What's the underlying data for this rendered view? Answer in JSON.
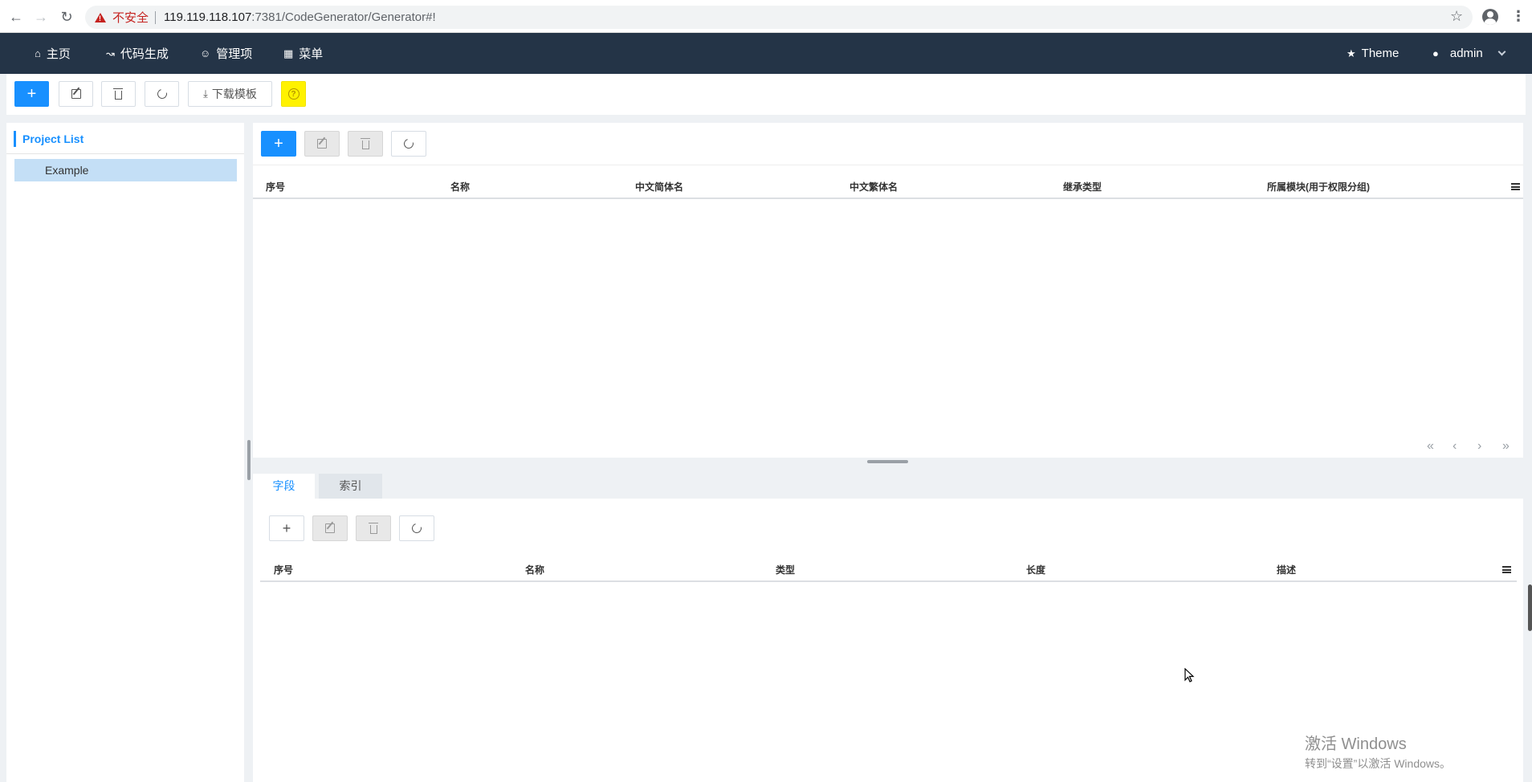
{
  "browser": {
    "insecure_label": "不安全",
    "url_host": "119.119.118.107",
    "url_rest": ":7381/CodeGenerator/Generator#!"
  },
  "nav": {
    "home": "主页",
    "codegen": "代码生成",
    "manage": "管理项",
    "menu": "菜单",
    "theme": "Theme",
    "user": "admin"
  },
  "toolbar": {
    "add": "+",
    "download_template": "下载模板",
    "help": "?"
  },
  "left": {
    "title": "Project List",
    "items": [
      "Example"
    ]
  },
  "table_top": {
    "add": "+",
    "columns": [
      "序号",
      "名称",
      "中文简体名",
      "中文繁体名",
      "继承类型",
      "所属模块(用于权限分组)"
    ],
    "pager": [
      "«",
      "‹",
      "›",
      "»"
    ]
  },
  "tabs": [
    "字段",
    "索引"
  ],
  "table_bottom": {
    "add": "+",
    "columns": [
      "序号",
      "名称",
      "类型",
      "长度",
      "描述"
    ]
  },
  "watermark": {
    "line1": "激活 Windows",
    "line2": "转到“设置”以激活 Windows。"
  },
  "icons": [
    "back-icon",
    "forward-icon",
    "reload-icon",
    "warning-icon",
    "star-icon",
    "account-icon",
    "kebab-icon",
    "home-icon",
    "chart-icon",
    "user-icon",
    "grid-icon",
    "shirt-icon",
    "edit-icon",
    "trash-icon",
    "refresh-icon",
    "download-icon",
    "help-icon",
    "menu-icon"
  ]
}
